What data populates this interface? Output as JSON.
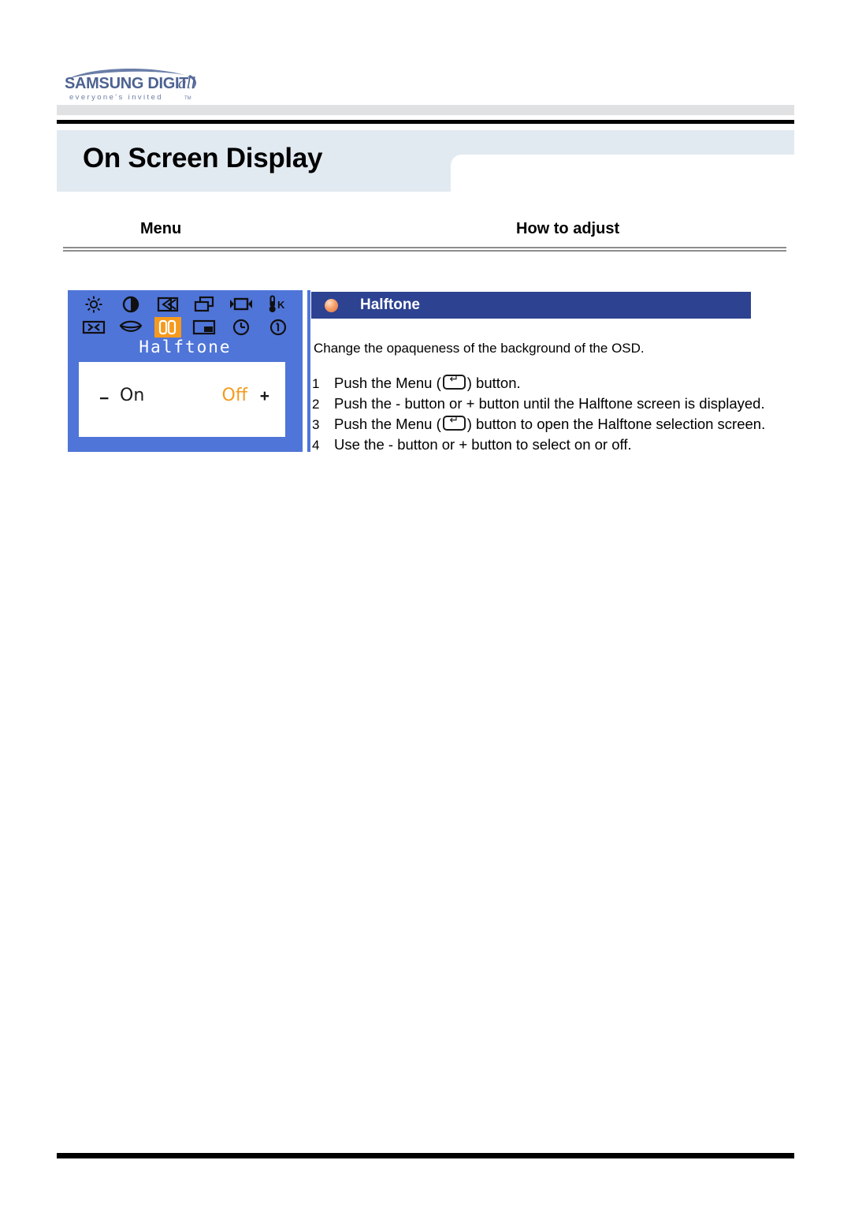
{
  "brand": {
    "logo_name": "SAMSUNG DIGITall",
    "logo_main": "SAMSUNG DIGIT",
    "logo_italic": "all",
    "logo_tagline": "everyone's invited",
    "logo_tm": "TM",
    "logo_color": "#5a6e9e"
  },
  "header": {
    "title": "On Screen Display",
    "band_color": "#e2eaf1"
  },
  "columns": {
    "left_label": "Menu",
    "right_label": "How to adjust"
  },
  "osd": {
    "background_color": "#5075d8",
    "highlight_color": "#f59a1e",
    "label": "Halftone",
    "minus": "−",
    "plus": "+",
    "option_left": "On",
    "option_right": "Off",
    "option_right_color": "#f59a1e",
    "icons_row1": [
      {
        "name": "brightness-icon",
        "title": "Brightness"
      },
      {
        "name": "contrast-icon",
        "title": "Contrast"
      },
      {
        "name": "h-position-icon",
        "title": "Horizontal Position"
      },
      {
        "name": "v-size-icon",
        "title": "Vertical Size"
      },
      {
        "name": "h-size-icon",
        "title": "Horizontal Size"
      },
      {
        "name": "color-temperature-icon",
        "title": "Color Temperature"
      }
    ],
    "icons_row2": [
      {
        "name": "pincushion-icon",
        "title": "Pincushion"
      },
      {
        "name": "trapezoid-icon",
        "title": "Trapezoid"
      },
      {
        "name": "halftone-icon",
        "title": "Halftone",
        "selected": true
      },
      {
        "name": "osd-position-icon",
        "title": "OSD Position"
      },
      {
        "name": "timer-icon",
        "title": "Timer"
      },
      {
        "name": "information-icon",
        "title": "Information"
      }
    ]
  },
  "panel": {
    "header_title": "Halftone",
    "header_color": "#2d4291",
    "bullet_color": "#e8814a",
    "intro": "Change the opaqueness of the background of the OSD.",
    "steps": [
      {
        "num": "1",
        "pre": "Push the Menu (",
        "post": ") button.",
        "has_icon": true
      },
      {
        "num": "2",
        "pre": "Push the - button or + button until the Halftone screen is displayed.",
        "post": "",
        "has_icon": false
      },
      {
        "num": "3",
        "pre": "Push the Menu (",
        "post": ") button to open the Halftone selection screen.",
        "has_icon": true
      },
      {
        "num": "4",
        "pre": "Use the - button or + button to select on or off.",
        "post": "",
        "has_icon": false
      }
    ]
  }
}
